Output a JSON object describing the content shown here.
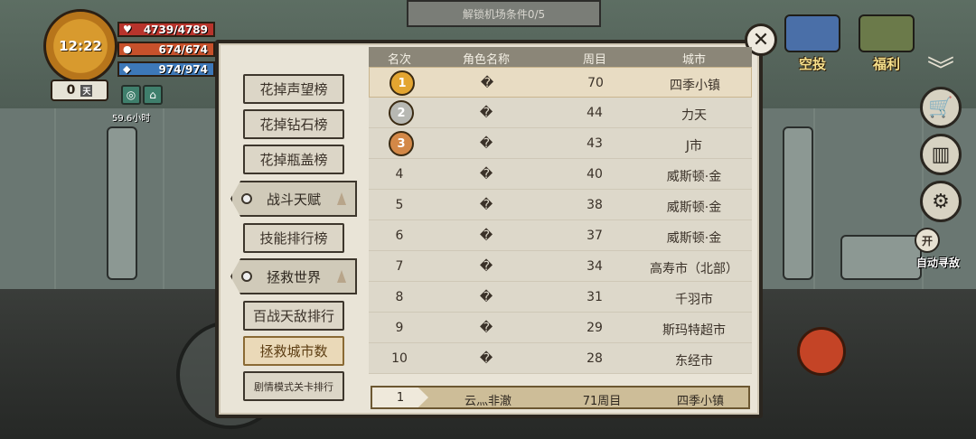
{
  "banner": "解锁机场条件0/5",
  "hud": {
    "time": "12:22",
    "hp": "4739/4789",
    "stamina": "674/674",
    "water": "974/974",
    "days": "0",
    "days_unit": "天",
    "hours": "59.6小时"
  },
  "right_hud": {
    "airdrop": "空投",
    "welfare": "福利",
    "auto_toggle": "开",
    "auto_label": "自动寻敌"
  },
  "sidebar": {
    "items": [
      {
        "label": "花掉声望榜"
      },
      {
        "label": "花掉钻石榜"
      },
      {
        "label": "花掉瓶盖榜"
      },
      {
        "label": "战斗天赋"
      },
      {
        "label": "技能排行榜"
      },
      {
        "label": "拯救世界"
      },
      {
        "label": "百战天敌排行"
      },
      {
        "label": "拯救城市数"
      },
      {
        "label": "剧情模式关卡排行"
      }
    ]
  },
  "table": {
    "headers": {
      "rank": "名次",
      "name": "角色名称",
      "week": "周目",
      "city": "城市"
    },
    "rows": [
      {
        "rank": "1",
        "name": "�",
        "week": "70",
        "city": "四季小镇"
      },
      {
        "rank": "2",
        "name": "�",
        "week": "44",
        "city": "力天"
      },
      {
        "rank": "3",
        "name": "�",
        "week": "43",
        "city": "J市"
      },
      {
        "rank": "4",
        "name": "�",
        "week": "40",
        "city": "威斯顿·金"
      },
      {
        "rank": "5",
        "name": "�",
        "week": "38",
        "city": "威斯顿·金"
      },
      {
        "rank": "6",
        "name": "�",
        "week": "37",
        "city": "威斯顿·金"
      },
      {
        "rank": "7",
        "name": "�",
        "week": "34",
        "city": "高寿市（北部）"
      },
      {
        "rank": "8",
        "name": "�",
        "week": "31",
        "city": "千羽市"
      },
      {
        "rank": "9",
        "name": "�",
        "week": "29",
        "city": "斯玛特超市"
      },
      {
        "rank": "10",
        "name": "�",
        "week": "28",
        "city": "东经市"
      }
    ]
  },
  "my_rank": {
    "rank": "1",
    "name": "云灬非澈",
    "week": "71周目",
    "city": "四季小镇"
  },
  "colors": {
    "gold": "#e3a531",
    "silver": "#b7b8b3",
    "bronze": "#d38847",
    "header": "#8b8678"
  }
}
